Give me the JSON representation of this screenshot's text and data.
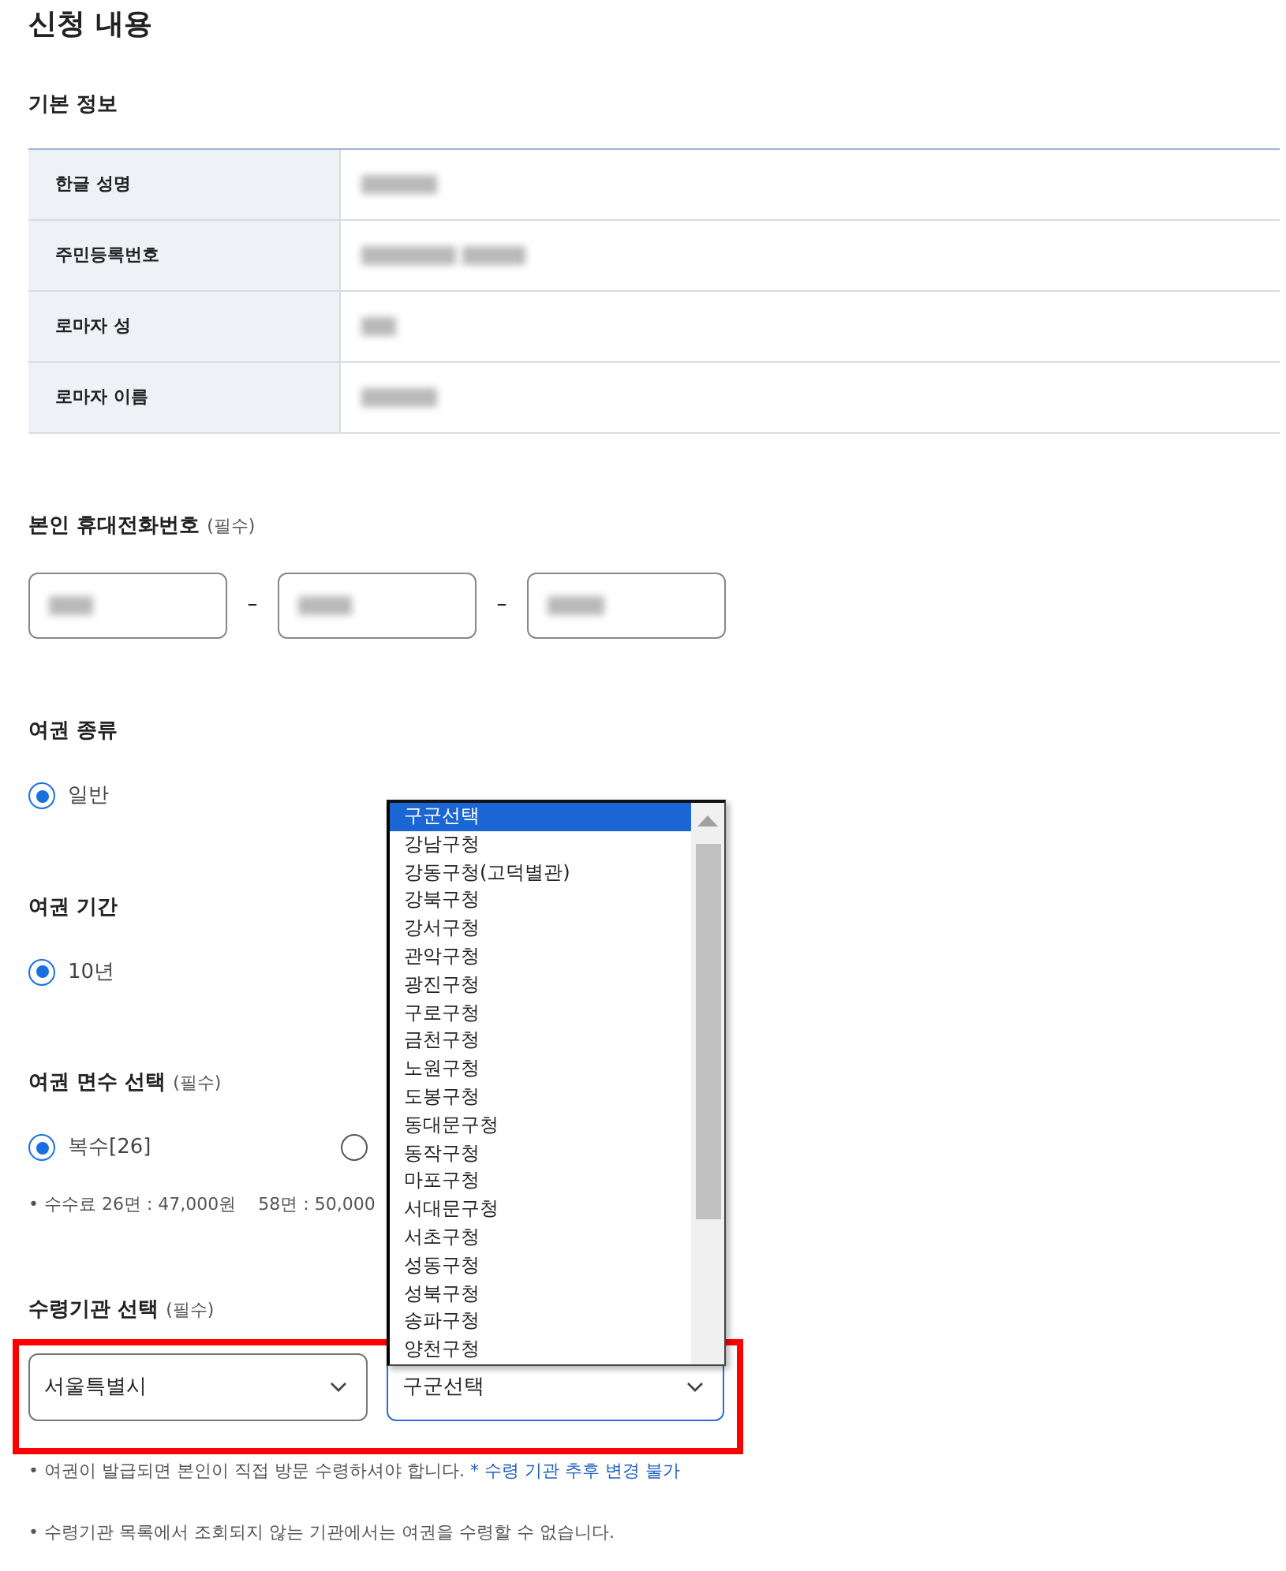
{
  "page_title": "신청 내용",
  "basic_info": {
    "title": "기본 정보",
    "rows": [
      {
        "label": "한글 성명"
      },
      {
        "label": "주민등록번호"
      },
      {
        "label": "로마자 성"
      },
      {
        "label": "로마자 이름"
      }
    ]
  },
  "phone": {
    "label": "본인 휴대전화번호",
    "required": "(필수)",
    "separators": [
      "–",
      "–"
    ]
  },
  "passport_type": {
    "label": "여권 종류",
    "options": [
      {
        "label": "일반",
        "selected": true
      }
    ]
  },
  "passport_period": {
    "label": "여권 기간",
    "options": [
      {
        "label": "10년",
        "selected": true
      }
    ]
  },
  "page_count": {
    "label": "여권 면수 선택",
    "required": "(필수)",
    "options": [
      {
        "label": "복수[26]",
        "selected": true
      },
      {
        "selected": false
      }
    ],
    "fees": [
      "• 수수료 26면 : 47,000원",
      "58면 : 50,000"
    ]
  },
  "agency": {
    "label": "수령기관 선택",
    "required": "(필수)",
    "highlighted": true,
    "city_select": {
      "value": "서울특별시",
      "focused": false
    },
    "district_select": {
      "value": "구군선택",
      "focused": true,
      "expanded": true,
      "options": [
        {
          "label": "구군선택",
          "selected": true
        },
        {
          "label": "강남구청",
          "selected": false
        },
        {
          "label": "강동구청(고덕별관)",
          "selected": false
        },
        {
          "label": "강북구청",
          "selected": false
        },
        {
          "label": "강서구청",
          "selected": false
        },
        {
          "label": "관악구청",
          "selected": false
        },
        {
          "label": "광진구청",
          "selected": false
        },
        {
          "label": "구로구청",
          "selected": false
        },
        {
          "label": "금천구청",
          "selected": false
        },
        {
          "label": "노원구청",
          "selected": false
        },
        {
          "label": "도봉구청",
          "selected": false
        },
        {
          "label": "동대문구청",
          "selected": false
        },
        {
          "label": "동작구청",
          "selected": false
        },
        {
          "label": "마포구청",
          "selected": false
        },
        {
          "label": "서대문구청",
          "selected": false
        },
        {
          "label": "서초구청",
          "selected": false
        },
        {
          "label": "성동구청",
          "selected": false
        },
        {
          "label": "성북구청",
          "selected": false
        },
        {
          "label": "송파구청",
          "selected": false
        },
        {
          "label": "양천구청",
          "selected": false
        }
      ]
    },
    "notes": [
      {
        "text": "• 여권이 발급되면 본인이 직접 방문 수령하셔야 합니다. ",
        "link": "* 수령 기관 추후 변경 불가"
      },
      {
        "text": "• 수령기관 목록에서 조회되지 않는 기관에서는 여권을 수령할 수 없습니다."
      }
    ]
  }
}
